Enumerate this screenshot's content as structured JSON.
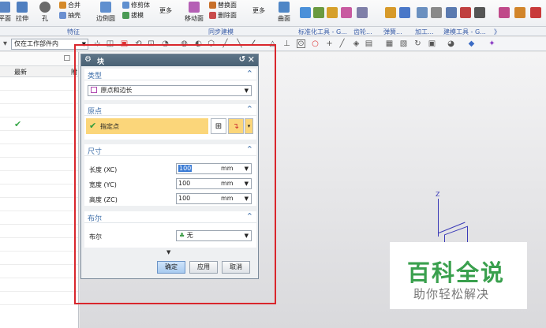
{
  "ribbon": {
    "tools_big": [
      {
        "label": "平面",
        "color": "#5a86c5"
      },
      {
        "label": "拉伸",
        "color": "#4f7fc0"
      },
      {
        "label": "孔",
        "color": "#6a6a6a"
      },
      {
        "label": "边倒圆",
        "color": "#5f8fcf"
      },
      {
        "label": "更多",
        "color": "#888888"
      },
      {
        "label": "移动面",
        "color": "#b55fb5"
      },
      {
        "label": "更多",
        "color": "#888888"
      },
      {
        "label": "曲面",
        "color": "#4f86c6"
      }
    ],
    "tools_small": [
      {
        "label": "合并",
        "color": "#d58a2a"
      },
      {
        "label": "抽壳",
        "color": "#6a8fd0"
      },
      {
        "label": "修剪体",
        "color": "#5f8fcf"
      },
      {
        "label": "拔模",
        "color": "#4a9a55"
      },
      {
        "label": "替换面",
        "color": "#c8702a"
      },
      {
        "label": "删除面",
        "color": "#c84b4b"
      }
    ],
    "groups": [
      {
        "label": "特征"
      },
      {
        "label": "同步建模"
      },
      {
        "label": "标准化工具 - G..."
      },
      {
        "label": "齿轮..."
      },
      {
        "label": "弹簧..."
      },
      {
        "label": "加工..."
      },
      {
        "label": "建模工具 - G..."
      },
      {
        "label": "》"
      }
    ]
  },
  "cmdbar": {
    "scope_value": "仅在工作部件内"
  },
  "nav": {
    "col_latest": "最新",
    "col_partial": "附",
    "checked_row_mark": "✔"
  },
  "dialog": {
    "title": "块",
    "sections": {
      "type": {
        "label": "类型",
        "select_value": "原点和边长"
      },
      "origin": {
        "label": "原点",
        "point_label": "指定点"
      },
      "size": {
        "label": "尺寸",
        "fields": [
          {
            "label": "长度 (XC)",
            "value": "100",
            "unit": "mm"
          },
          {
            "label": "宽度 (YC)",
            "value": "100",
            "unit": "mm"
          },
          {
            "label": "高度 (ZC)",
            "value": "100",
            "unit": "mm"
          }
        ]
      },
      "boolean": {
        "label": "布尔",
        "field_label": "布尔",
        "select_value": "无"
      }
    },
    "buttons": {
      "ok": "确定",
      "apply": "应用",
      "cancel": "取消"
    }
  },
  "viewport": {
    "axis_label": "Z"
  },
  "watermark": {
    "line1": "百科全说",
    "line2": "助你轻松解决"
  }
}
